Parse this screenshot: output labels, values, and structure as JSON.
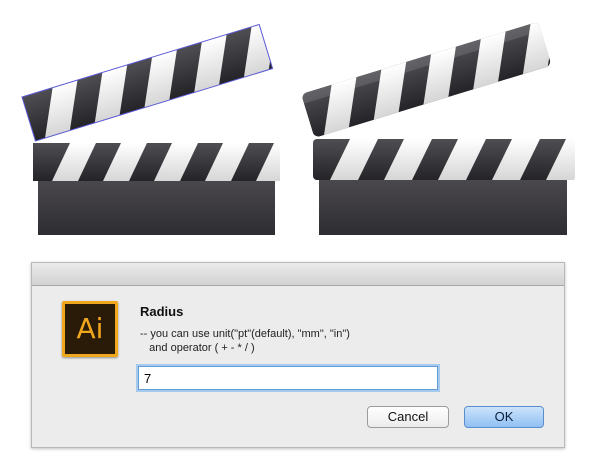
{
  "dialog": {
    "app_icon_label": "Ai",
    "title": "Radius",
    "hint_line_1": "-- you can use unit(\"pt\"(default), \"mm\", \"in\")",
    "hint_line_2": "   and operator ( + - * / )",
    "input_value": "7",
    "cancel_label": "Cancel",
    "ok_label": "OK"
  },
  "colors": {
    "clapper_dark": "#3a393d",
    "clapper_stripe_light": "#f2f2f2",
    "accent_blue": "#5f9ed8",
    "ai_orange": "#f1a71d"
  },
  "icons": {
    "app_icon": "adobe-illustrator-icon"
  }
}
